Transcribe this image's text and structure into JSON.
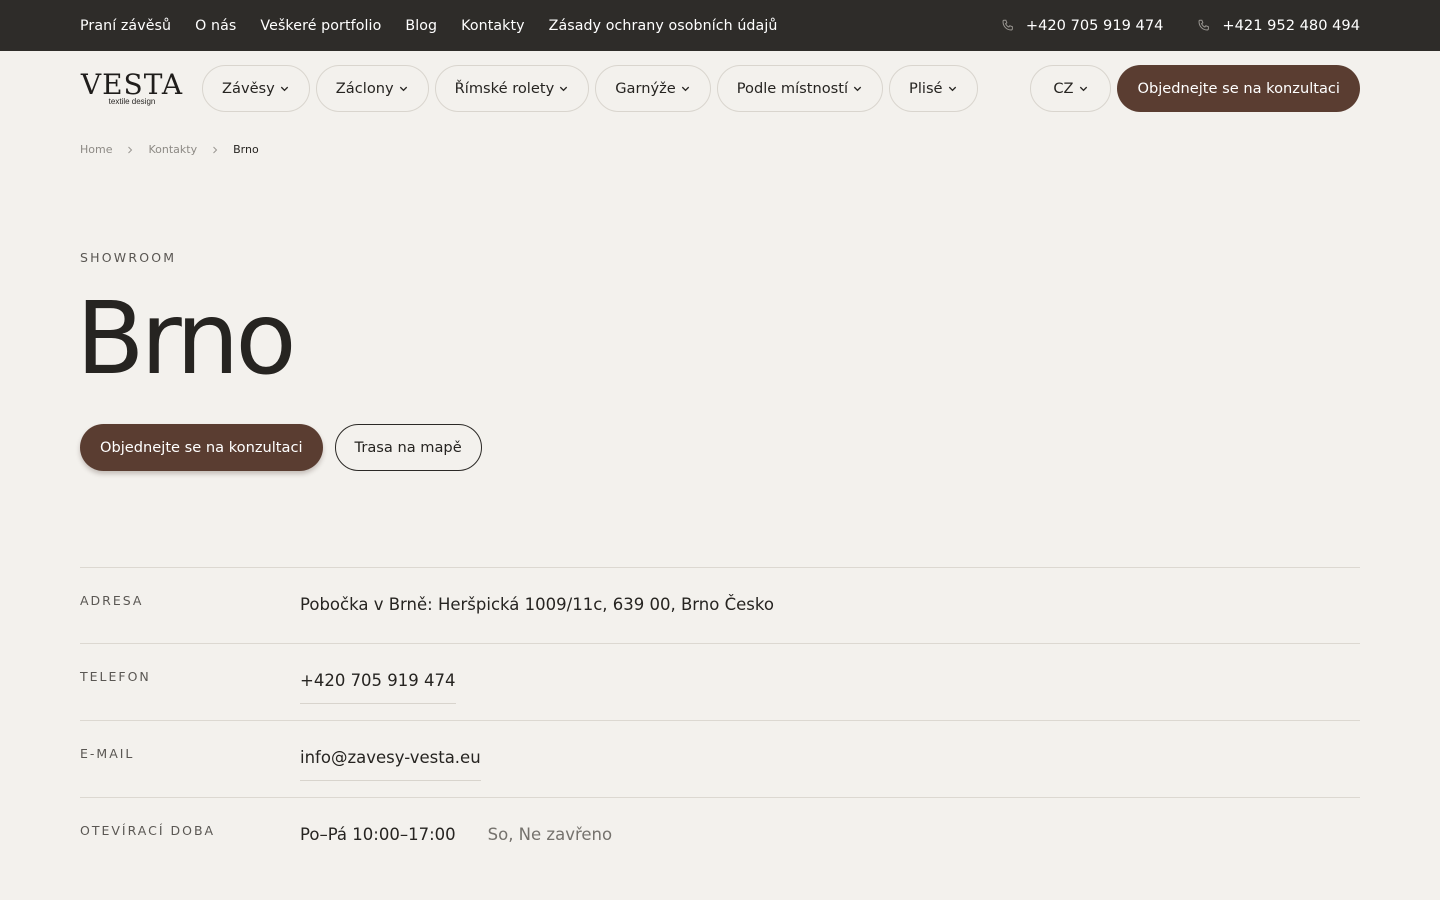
{
  "topbar": {
    "links": [
      "Praní závěsů",
      "O nás",
      "Veškeré portfolio",
      "Blog",
      "Kontakty",
      "Zásady ochrany osobních údajů"
    ],
    "phones": [
      "+420 705 919 474",
      "+421 952 480 494"
    ]
  },
  "header": {
    "logo_word": "VESTA",
    "logo_sub": "textile design",
    "menu": [
      "Závěsy",
      "Záclony",
      "Římské rolety",
      "Garnýže",
      "Podle místností",
      "Plisé"
    ],
    "lang": "CZ",
    "cta": "Objednejte se na konzultaci"
  },
  "breadcrumb": [
    "Home",
    "Kontakty",
    "Brno"
  ],
  "hero": {
    "eyebrow": "SHOWROOM",
    "title": "Brno",
    "primary_button": "Objednejte se na konzultaci",
    "secondary_button": "Trasa na mapě"
  },
  "info": {
    "address_label": "ADRESA",
    "address": "Pobočka v Brně: Heršpická 1009/11c, 639 00, Brno Česko",
    "phone_label": "TELEFON",
    "phone": "+420 705 919 474",
    "email_label": "E-MAIL",
    "email": "info@zavesy-vesta.eu",
    "hours_label": "OTEVÍRACÍ DOBA",
    "hours_weekdays": "Po–Pá 10:00–17:00",
    "hours_weekend": "So, Ne zavřeno"
  },
  "colors": {
    "background": "#f3f1ed",
    "topbar": "#2e2c29",
    "accent": "#5a3d31"
  }
}
